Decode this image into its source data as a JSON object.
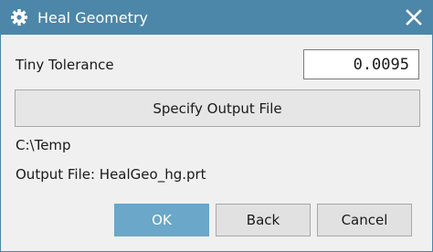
{
  "window": {
    "title": "Heal Geometry",
    "title_icon": "gear-icon",
    "close_icon": "close-icon"
  },
  "tolerance": {
    "label": "Tiny Tolerance",
    "value": "0.0095"
  },
  "specify_button": {
    "label": "Specify Output File"
  },
  "paths": {
    "directory": "C:\\Temp",
    "output_file": "Output File: HealGeo_hg.prt"
  },
  "buttons": {
    "ok": "OK",
    "back": "Back",
    "cancel": "Cancel"
  },
  "colors": {
    "titlebar": "#4c86a8",
    "ok_button": "#6aa7c8"
  }
}
